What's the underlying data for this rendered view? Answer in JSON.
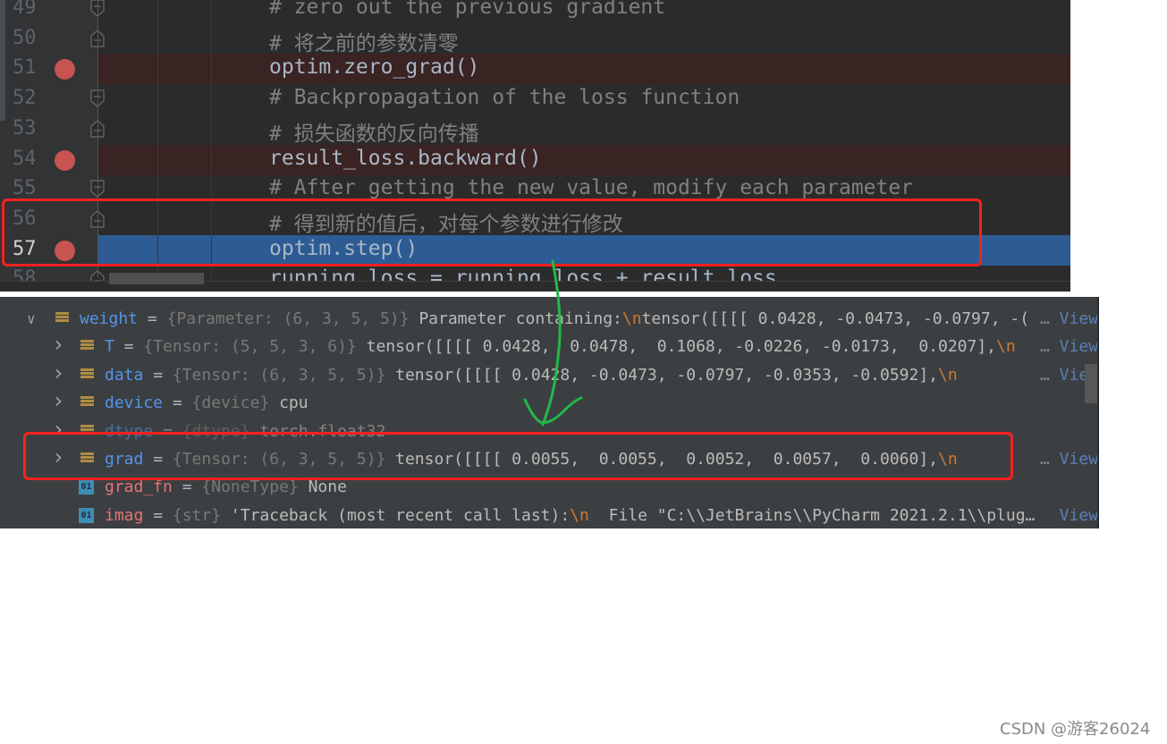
{
  "editor": {
    "lines": [
      {
        "num": "49",
        "text": "# zero out the previous gradient",
        "kind": "comment",
        "breakpoint": false,
        "current": false,
        "fold": "end"
      },
      {
        "num": "50",
        "text": "# 将之前的参数清零",
        "kind": "comment",
        "breakpoint": false,
        "current": false,
        "fold": "start"
      },
      {
        "num": "51",
        "text": "optim.zero_grad()",
        "kind": "code",
        "breakpoint": true,
        "current": false,
        "fold": ""
      },
      {
        "num": "52",
        "text": "# Backpropagation of the loss function",
        "kind": "comment",
        "breakpoint": false,
        "current": false,
        "fold": "end"
      },
      {
        "num": "53",
        "text": "# 损失函数的反向传播",
        "kind": "comment",
        "breakpoint": false,
        "current": false,
        "fold": "start"
      },
      {
        "num": "54",
        "text": "result_loss.backward()",
        "kind": "code",
        "breakpoint": true,
        "current": false,
        "fold": ""
      },
      {
        "num": "55",
        "text": "# After getting the new value, modify each parameter",
        "kind": "comment",
        "breakpoint": false,
        "current": false,
        "fold": "end"
      },
      {
        "num": "56",
        "text": "# 得到新的值后，对每个参数进行修改",
        "kind": "comment",
        "breakpoint": false,
        "current": false,
        "fold": "start"
      },
      {
        "num": "57",
        "text": "optim.step()",
        "kind": "code",
        "breakpoint": true,
        "current": true,
        "fold": ""
      },
      {
        "num": "58",
        "text": "running_loss = running_loss + result_loss",
        "kind": "code",
        "breakpoint": false,
        "current": false,
        "fold": "start"
      }
    ]
  },
  "variables": {
    "rows": [
      {
        "expand": "expanded",
        "icon": "field",
        "name": "weight",
        "name_color": "blue",
        "type": "{Parameter: (6, 3, 5, 5)}",
        "value_pre": " Parameter containing:",
        "esc": "\\n",
        "value_post": "tensor([[[[ 0.0428, -0.0473, -0.0797, -(",
        "ellipsis": "…",
        "view": "View",
        "indent": 0
      },
      {
        "expand": "collapsed",
        "icon": "field",
        "name": "T",
        "name_color": "blue",
        "type": "{Tensor: (5, 5, 3, 6)}",
        "value_pre": " tensor([[[[ 0.0428,  0.0478,  0.1068, -0.0226, -0.0173,  0.0207],",
        "esc": "\\n",
        "value_post": "",
        "ellipsis": "…",
        "view": "View",
        "indent": 1
      },
      {
        "expand": "collapsed",
        "icon": "field",
        "name": "data",
        "name_color": "blue",
        "type": "{Tensor: (6, 3, 5, 5)}",
        "value_pre": " tensor([[[[ 0.0428, -0.0473, -0.0797, -0.0353, -0.0592],",
        "esc": "\\n",
        "value_post": "",
        "ellipsis": "…",
        "view": "View",
        "indent": 1
      },
      {
        "expand": "collapsed",
        "icon": "field",
        "name": "device",
        "name_color": "blue",
        "type": "{device}",
        "value_pre": " cpu",
        "esc": "",
        "value_post": "",
        "ellipsis": "",
        "view": "",
        "indent": 1
      },
      {
        "expand": "collapsed",
        "icon": "field",
        "name": "dtype",
        "name_color": "blue",
        "type": "{dtype}",
        "value_pre": " torch.float32",
        "esc": "",
        "value_post": "",
        "ellipsis": "",
        "view": "",
        "indent": 1,
        "dim": true
      },
      {
        "expand": "collapsed",
        "icon": "field",
        "name": "grad",
        "name_color": "blue",
        "type": "{Tensor: (6, 3, 5, 5)}",
        "value_pre": " tensor([[[[ 0.0055,  0.0055,  0.0052,  0.0057,  0.0060],",
        "esc": "\\n",
        "value_post": "",
        "ellipsis": "…",
        "view": "View",
        "indent": 1
      },
      {
        "expand": "none",
        "icon": "01",
        "name": "grad_fn",
        "name_color": "red",
        "type": "{NoneType}",
        "value_pre": " None",
        "esc": "",
        "value_post": "",
        "ellipsis": "",
        "view": "",
        "indent": 1
      },
      {
        "expand": "none",
        "icon": "01",
        "name": "imag",
        "name_color": "red",
        "type": "{str}",
        "value_pre": " 'Traceback (most recent call last):",
        "esc": "\\n",
        "value_post": "  File \"C:\\\\JetBrains\\\\PyCharm 2021.2.1\\\\plug…",
        "ellipsis": "",
        "view": "View",
        "indent": 1
      }
    ]
  },
  "annotations": {
    "highlight_color": "#ff2020",
    "arrow_color": "#22b84a"
  },
  "watermark": "CSDN @游客26024"
}
